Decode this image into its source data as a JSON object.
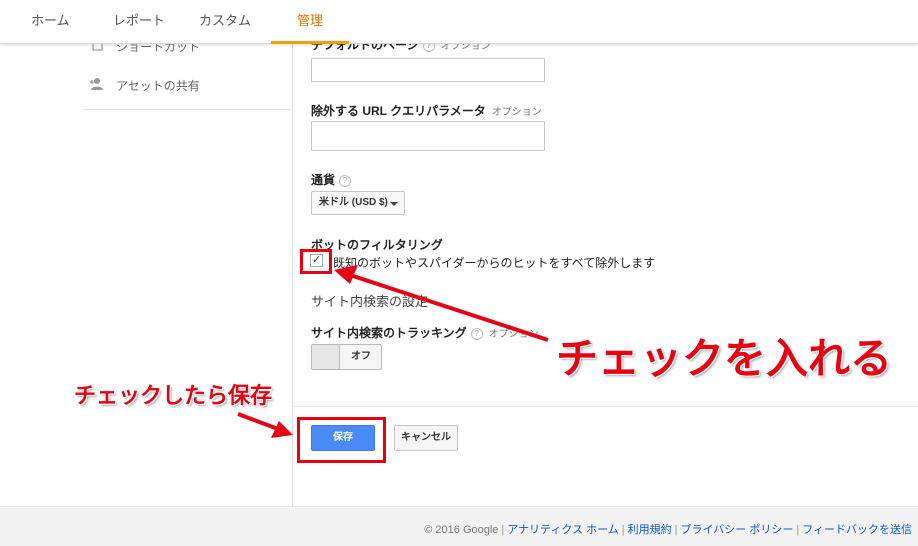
{
  "nav": {
    "tabs": [
      {
        "label": "ホーム"
      },
      {
        "label": "レポート"
      },
      {
        "label": "カスタム"
      },
      {
        "label": "管理",
        "active": true
      }
    ]
  },
  "sidebar": {
    "items": [
      {
        "label": "ショートカット",
        "icon": "shortcut-icon"
      },
      {
        "label": "アセットの共有",
        "icon": "person-add-icon"
      }
    ]
  },
  "form": {
    "default_page": {
      "label": "デフォルトのページ",
      "optional": "オプション",
      "value": ""
    },
    "exclude_params": {
      "label": "除外する URL クエリパラメータ",
      "optional": "オプション",
      "value": ""
    },
    "currency": {
      "label": "通貨",
      "selected": "米ドル (USD $)"
    },
    "bot_filtering": {
      "label": "ボットのフィルタリング",
      "checkbox_label": "既知のボットやスパイダーからのヒットをすべて除外します",
      "checked": true,
      "check_glyph": "✓"
    },
    "site_search": {
      "section_title": "サイト内検索の設定",
      "label": "サイト内検索のトラッキング",
      "optional": "オプション",
      "toggle_value": "オフ"
    },
    "buttons": {
      "save": "保存",
      "cancel": "キャンセル"
    }
  },
  "annotations": {
    "check_text": "チェックを入れる",
    "save_text": "チェックしたら保存",
    "color": "#e60012"
  },
  "footer": {
    "copyright": "© 2016 Google",
    "links": [
      "アナリティクス ホーム",
      "利用規約",
      "プライバシー ポリシー",
      "フィードバックを送信"
    ]
  },
  "colors": {
    "accent": "#f0a100",
    "primary_button": "#4a8af4",
    "link": "#1155cc"
  }
}
